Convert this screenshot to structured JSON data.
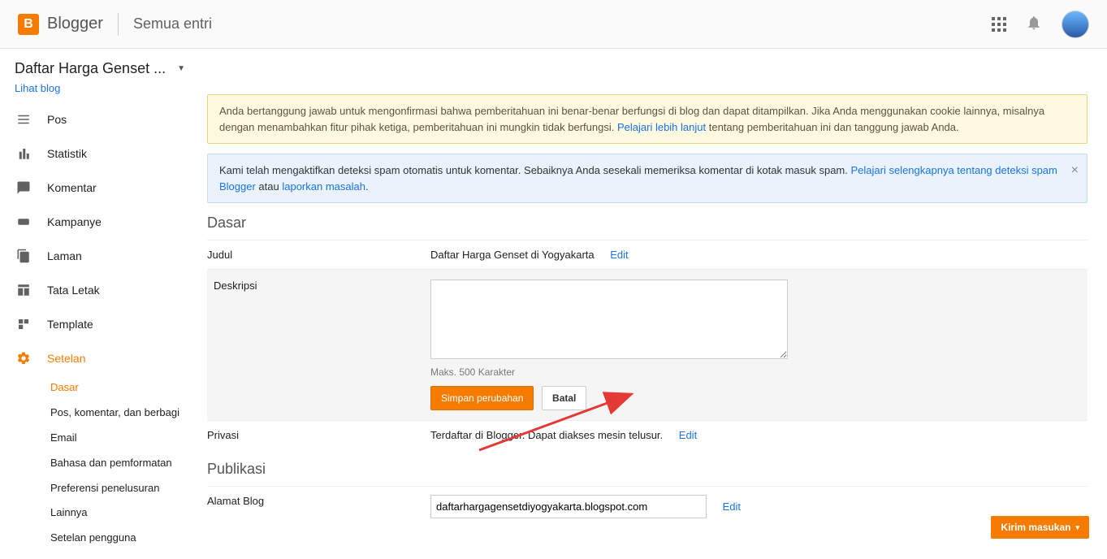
{
  "header": {
    "brand": "Blogger",
    "page": "Semua entri"
  },
  "blog": {
    "name": "Daftar Harga Genset ...",
    "view": "Lihat blog"
  },
  "nav": {
    "pos": "Pos",
    "statistik": "Statistik",
    "komentar": "Komentar",
    "kampanye": "Kampanye",
    "laman": "Laman",
    "tataletak": "Tata Letak",
    "template": "Template",
    "setelan": "Setelan"
  },
  "subnav": {
    "dasar": "Dasar",
    "pos_komentar": "Pos, komentar, dan berbagi",
    "email": "Email",
    "bahasa": "Bahasa dan pemformatan",
    "preferensi": "Preferensi penelusuran",
    "lainnya": "Lainnya",
    "pengguna": "Setelan pengguna"
  },
  "notice_yellow": {
    "t1": "Anda bertanggung jawab untuk mengonfirmasi bahwa pemberitahuan ini benar-benar berfungsi di blog dan dapat ditampilkan. Jika Anda menggunakan cookie lainnya, misalnya dengan menambahkan fitur pihak ketiga, pemberitahuan ini mungkin tidak berfungsi. ",
    "link": "Pelajari lebih lanjut",
    "t2": " tentang pemberitahuan ini dan tanggung jawab Anda."
  },
  "notice_blue": {
    "t1": "Kami telah mengaktifkan deteksi spam otomatis untuk komentar. Sebaiknya Anda sesekali memeriksa komentar di kotak masuk spam. ",
    "link1": "Pelajari selengkapnya tentang deteksi spam Blogger",
    "mid": " atau ",
    "link2": "laporkan masalah"
  },
  "sections": {
    "dasar": "Dasar",
    "publikasi": "Publikasi"
  },
  "labels": {
    "judul": "Judul",
    "deskripsi": "Deskripsi",
    "privasi": "Privasi",
    "alamat": "Alamat Blog",
    "edit": "Edit"
  },
  "values": {
    "judul": "Daftar Harga Genset di Yogyakarta",
    "desc_hint": "Maks. 500 Karakter",
    "privasi": "Terdaftar di Blogger. Dapat diakses mesin telusur.",
    "alamat": "daftarhargagensetdiyogyakarta.blogspot.com"
  },
  "buttons": {
    "save": "Simpan perubahan",
    "cancel": "Batal",
    "feedback": "Kirim masukan"
  }
}
